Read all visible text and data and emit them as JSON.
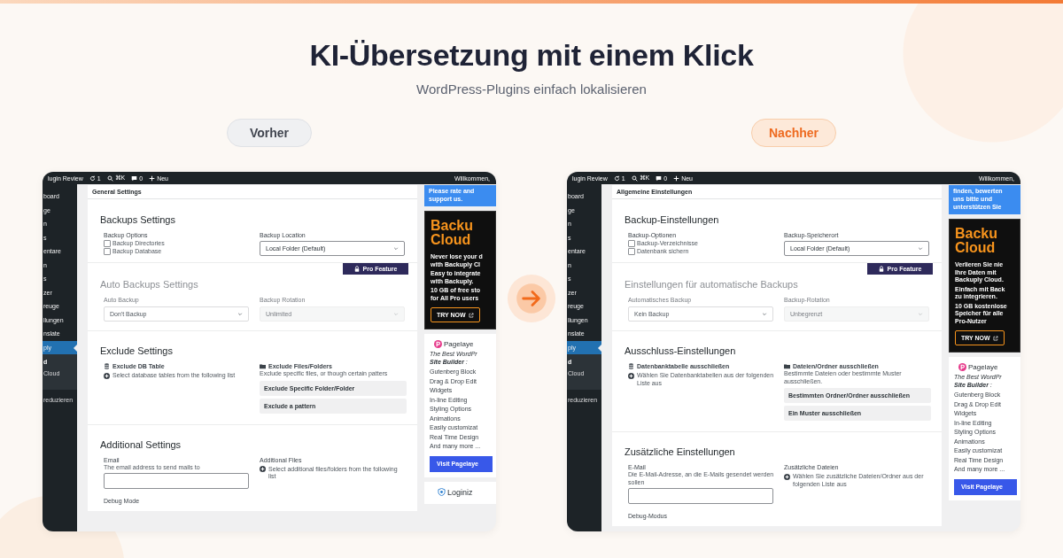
{
  "header": {
    "title": "KI-Übersetzung mit einem Klick",
    "subtitle": "WordPress-Plugins einfach lokalisieren"
  },
  "panels": [
    {
      "tag": {
        "label": "Vorher",
        "highlighted": false
      },
      "admin_bar": {
        "site": "lugin Review",
        "updates": "1",
        "search": "⌘K",
        "comments": "0",
        "new": "Neu",
        "greeting": "Willkommen,"
      },
      "sidebar": [
        {
          "kind": "menu",
          "label": "board",
          "selected": false
        },
        {
          "kind": "menu",
          "label": "ge",
          "selected": false
        },
        {
          "kind": "menu",
          "label": "n",
          "selected": false
        },
        {
          "kind": "menu",
          "label": "s",
          "selected": false
        },
        {
          "kind": "menu",
          "label": "entare",
          "selected": false
        },
        {
          "kind": "menu",
          "label": "n",
          "selected": false
        },
        {
          "kind": "menu",
          "label": "s",
          "selected": false
        },
        {
          "kind": "menu",
          "label": "zer",
          "selected": false
        },
        {
          "kind": "menu",
          "label": "reuge",
          "selected": false
        },
        {
          "kind": "menu",
          "label": "llungen",
          "selected": false
        },
        {
          "kind": "menu",
          "label": "nslate",
          "selected": false
        },
        {
          "kind": "menu",
          "label": "ply",
          "selected": true,
          "children": [
            {
              "label": "d",
              "selected": true
            },
            {
              "label": "Cloud",
              "selected": false
            }
          ]
        },
        {
          "kind": "collapse",
          "label": "reduzieren",
          "selected": false
        }
      ],
      "page_title": "General Settings",
      "sections": [
        {
          "title": "Backups Settings",
          "locked": false,
          "fields": [
            {
              "kind": "checkboxes",
              "label": "Backup Options",
              "options": [
                {
                  "label": "Backup Directories",
                  "checked": false
                },
                {
                  "label": "Backup Database",
                  "checked": false
                }
              ]
            },
            {
              "kind": "select",
              "label": "Backup Location",
              "value": "Local Folder (Default)",
              "disabled": false
            }
          ]
        },
        {
          "title": "Auto Backups Settings",
          "locked": true,
          "badge": "Pro Feature",
          "fields": [
            {
              "kind": "select",
              "label": "Auto Backup",
              "value": "Don't Backup",
              "disabled": false
            },
            {
              "kind": "select",
              "label": "Backup Rotation",
              "value": "Unlimited",
              "disabled": true
            }
          ]
        },
        {
          "title": "Exclude Settings",
          "locked": false,
          "fields": [
            {
              "kind": "table-picker",
              "label": "Exclude DB Table",
              "hint": "Select database tables from the following list"
            },
            {
              "kind": "pattern-list",
              "label": "Exclude Files/Folders",
              "description": "Exclude specific files, or though certain patters",
              "buttons": [
                "Exclude Specific Folder/Folder",
                "Exclude a pattern"
              ]
            }
          ]
        },
        {
          "title": "Additional Settings",
          "locked": false,
          "fields": [
            {
              "kind": "input",
              "label": "Email",
              "description": "The email address to send mails to"
            },
            {
              "kind": "file-picker",
              "label": "Additional Files",
              "hint": "Select additional files/folders from the following list"
            },
            {
              "kind": "label",
              "label": "Debug Mode"
            }
          ]
        }
      ],
      "widgets": [
        {
          "kind": "rate",
          "text": "Please rate and\nsupport us."
        },
        {
          "kind": "promo",
          "title": "Backu\nCloud",
          "paragraphs": [
            "Never lose your d\nwith Backuply Cl",
            "Easy to integrate\nwith Backuply.",
            "10 GB of free sto\nfor All Pro users"
          ],
          "button": "TRY NOW"
        },
        {
          "kind": "pagelayer",
          "name": "Pagelaye",
          "tagline": "The Best WordPr\n**Site Builder** :",
          "features": [
            "Gutenberg Block",
            "Drag & Drop Edit",
            "Widgets",
            "In-line Editing",
            "Styling Options",
            "Animations",
            "Easily customizat",
            "Real Time Design",
            "And many more ..."
          ],
          "button": "Visit Pagelaye"
        },
        {
          "kind": "loginize",
          "name": "Loginiz"
        }
      ]
    },
    {
      "tag": {
        "label": "Nachher",
        "highlighted": true
      },
      "admin_bar": {
        "site": "lugin Review",
        "updates": "1",
        "search": "⌘K",
        "comments": "0",
        "new": "Neu",
        "greeting": "Willkommen,"
      },
      "sidebar": [
        {
          "kind": "menu",
          "label": "board",
          "selected": false
        },
        {
          "kind": "menu",
          "label": "ge",
          "selected": false
        },
        {
          "kind": "menu",
          "label": "n",
          "selected": false
        },
        {
          "kind": "menu",
          "label": "s",
          "selected": false
        },
        {
          "kind": "menu",
          "label": "entare",
          "selected": false
        },
        {
          "kind": "menu",
          "label": "n",
          "selected": false
        },
        {
          "kind": "menu",
          "label": "s",
          "selected": false
        },
        {
          "kind": "menu",
          "label": "zer",
          "selected": false
        },
        {
          "kind": "menu",
          "label": "reuge",
          "selected": false
        },
        {
          "kind": "menu",
          "label": "llungen",
          "selected": false
        },
        {
          "kind": "menu",
          "label": "nslate",
          "selected": false
        },
        {
          "kind": "menu",
          "label": "ply",
          "selected": true,
          "children": [
            {
              "label": "d",
              "selected": true
            },
            {
              "label": "Cloud",
              "selected": false
            }
          ]
        },
        {
          "kind": "collapse",
          "label": "reduzieren",
          "selected": false
        }
      ],
      "page_title": "Allgemeine Einstellungen",
      "sections": [
        {
          "title": "Backup-Einstellungen",
          "locked": false,
          "fields": [
            {
              "kind": "checkboxes",
              "label": "Backup-Optionen",
              "options": [
                {
                  "label": "Backup-Verzeichnisse",
                  "checked": false
                },
                {
                  "label": "Datenbank sichern",
                  "checked": false
                }
              ]
            },
            {
              "kind": "select",
              "label": "Backup-Speicherort",
              "value": "Local Folder (Default)",
              "disabled": false
            }
          ]
        },
        {
          "title": "Einstellungen für automatische Backups",
          "locked": true,
          "badge": "Pro Feature",
          "fields": [
            {
              "kind": "select",
              "label": "Automatisches Backup",
              "value": "Kein Backup",
              "disabled": false
            },
            {
              "kind": "select",
              "label": "Backup-Rotation",
              "value": "Unbegrenzt",
              "disabled": true
            }
          ]
        },
        {
          "title": "Ausschluss-Einstellungen",
          "locked": false,
          "fields": [
            {
              "kind": "table-picker",
              "label": "Datenbanktabelle ausschließen",
              "hint": "Wählen Sie Datenbanktabellen aus der folgenden Liste aus"
            },
            {
              "kind": "pattern-list",
              "label": "Dateien/Ordner ausschließen",
              "description": "Bestimmte Dateien oder bestimmte Muster ausschließen.",
              "buttons": [
                "Bestimmten Ordner/Ordner ausschließen",
                "Ein Muster ausschließen"
              ]
            }
          ]
        },
        {
          "title": "Zusätzliche Einstellungen",
          "locked": false,
          "fields": [
            {
              "kind": "input",
              "label": "E-Mail",
              "description": "Die E-Mail-Adresse, an die E-Mails gesendet werden sollen"
            },
            {
              "kind": "file-picker",
              "label": "Zusätzliche Dateien",
              "hint": "Wählen Sie zusätzliche Dateien/Ordner aus der folgenden Liste aus"
            },
            {
              "kind": "label",
              "label": "Debug-Modus"
            }
          ]
        }
      ],
      "widgets": [
        {
          "kind": "rate",
          "text": "finden, bewerten\nuns bitte und\nunterstützen Sie"
        },
        {
          "kind": "promo",
          "title": "Backu\nCloud",
          "paragraphs": [
            "Verlieren Sie nie\nIhre Daten mit\nBackuply Cloud.",
            "Einfach mit Back\nzu integrieren.",
            "10 GB kostenlose\nSpeicher für alle\nPro-Nutzer"
          ],
          "button": "TRY NOW"
        },
        {
          "kind": "pagelayer",
          "name": "Pagelaye",
          "tagline": "The Best WordPr\n**Site Builder** :",
          "features": [
            "Gutenberg Block",
            "Drag & Drop Edit",
            "Widgets",
            "In-line Editing",
            "Styling Options",
            "Animations",
            "Easily customizat",
            "Real Time Design",
            "And many more ..."
          ],
          "button": "Visit Pagelaye"
        }
      ]
    }
  ]
}
